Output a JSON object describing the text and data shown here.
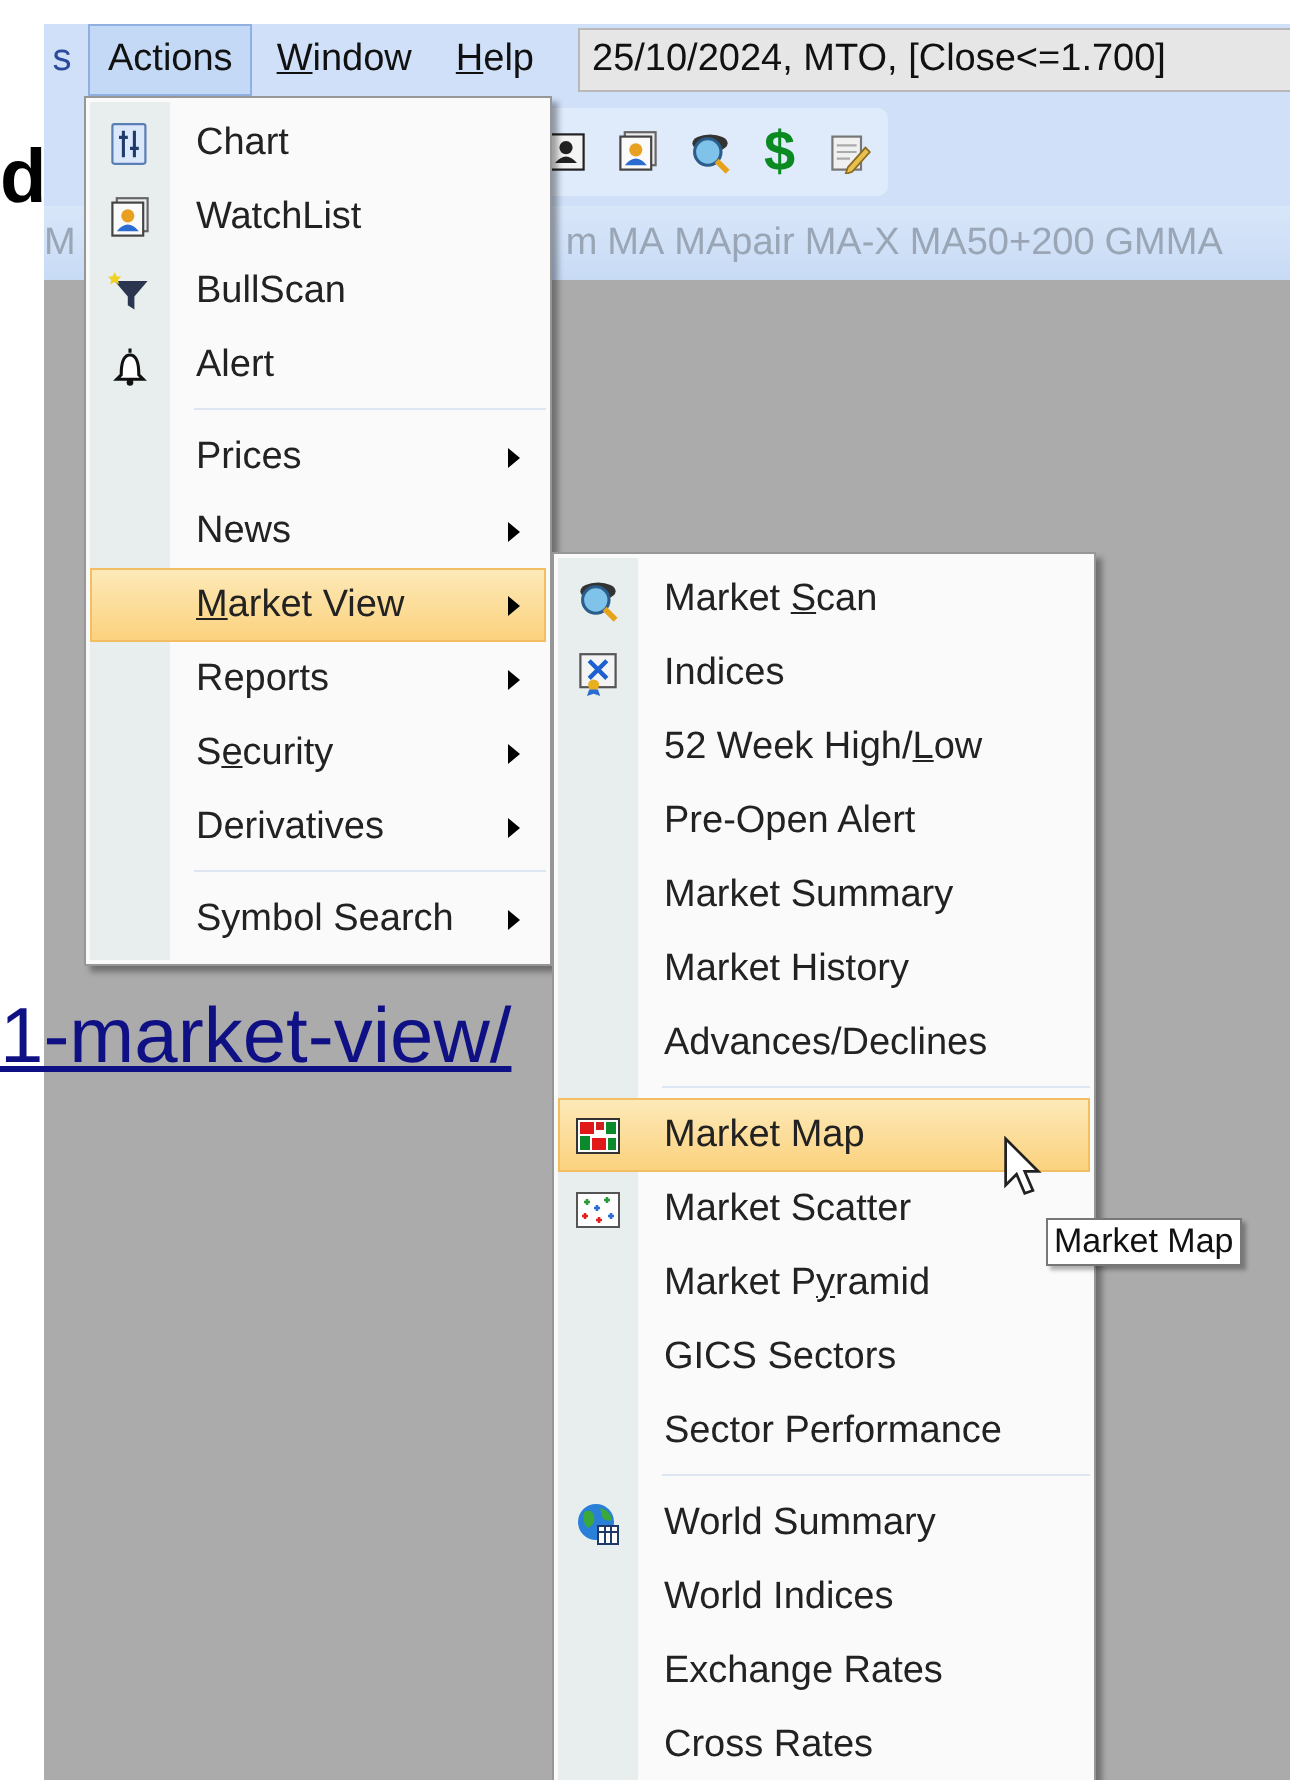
{
  "page_fragments": {
    "heading_letter": "d",
    "link": "1-market-view/"
  },
  "menubar": [
    {
      "label": [
        {
          "text": "s",
          "underline": false
        }
      ],
      "selected": false
    },
    {
      "label": [
        {
          "text": "Actions",
          "underline": false
        }
      ],
      "selected": true
    },
    {
      "label": [
        {
          "text": "W",
          "underline": true
        },
        {
          "text": "indow",
          "underline": false
        }
      ],
      "selected": false
    },
    {
      "label": [
        {
          "text": "H",
          "underline": true
        },
        {
          "text": "elp",
          "underline": false
        }
      ],
      "selected": false
    }
  ],
  "status_field": {
    "value": "25/10/2024, MTO, [Close<=1.700]"
  },
  "toolbar": [
    {
      "kind": "icon"
    },
    {
      "kind": "icon"
    },
    {
      "kind": "icon"
    },
    {
      "kind": "glyph",
      "label": "$"
    },
    {
      "kind": "icon"
    }
  ],
  "indicator_tabs": [
    "M",
    "m",
    "MA",
    "MApair",
    "MA-X",
    "MA50+200",
    "GMMA"
  ],
  "actions_menu": [
    {
      "kind": "item",
      "label": [
        {
          "text": "Chart",
          "underline": false
        }
      ],
      "selected": false,
      "has_submenu": false
    },
    {
      "kind": "item",
      "label": [
        {
          "text": "WatchList",
          "underline": false
        }
      ],
      "selected": false,
      "has_submenu": false
    },
    {
      "kind": "item",
      "label": [
        {
          "text": "BullScan",
          "underline": false
        }
      ],
      "selected": false,
      "has_submenu": false
    },
    {
      "kind": "item",
      "label": [
        {
          "text": "Alert",
          "underline": false
        }
      ],
      "selected": false,
      "has_submenu": false
    },
    {
      "kind": "separator"
    },
    {
      "kind": "item",
      "label": [
        {
          "text": "Prices",
          "underline": false
        }
      ],
      "selected": false,
      "has_submenu": true
    },
    {
      "kind": "item",
      "label": [
        {
          "text": "News",
          "underline": false
        }
      ],
      "selected": false,
      "has_submenu": true
    },
    {
      "kind": "item",
      "label": [
        {
          "text": "M",
          "underline": true
        },
        {
          "text": "arket View",
          "underline": false
        }
      ],
      "selected": true,
      "has_submenu": true
    },
    {
      "kind": "item",
      "label": [
        {
          "text": "Reports",
          "underline": false
        }
      ],
      "selected": false,
      "has_submenu": true
    },
    {
      "kind": "item",
      "label": [
        {
          "text": "S",
          "underline": false
        },
        {
          "text": "e",
          "underline": true
        },
        {
          "text": "curity",
          "underline": false
        }
      ],
      "selected": false,
      "has_submenu": true
    },
    {
      "kind": "item",
      "label": [
        {
          "text": "Derivatives",
          "underline": false
        }
      ],
      "selected": false,
      "has_submenu": true
    },
    {
      "kind": "separator"
    },
    {
      "kind": "item",
      "label": [
        {
          "text": "Symbol Search",
          "underline": false
        }
      ],
      "selected": false,
      "has_submenu": true
    }
  ],
  "market_view_menu": [
    {
      "kind": "item",
      "label": [
        {
          "text": "Market ",
          "underline": false
        },
        {
          "text": "S",
          "underline": true
        },
        {
          "text": "can",
          "underline": false
        }
      ],
      "selected": false
    },
    {
      "kind": "item",
      "label": [
        {
          "text": "Indices",
          "underline": false
        }
      ],
      "selected": false
    },
    {
      "kind": "item",
      "label": [
        {
          "text": "52 Week High/",
          "underline": false
        },
        {
          "text": "L",
          "underline": true
        },
        {
          "text": "ow",
          "underline": false
        }
      ],
      "selected": false
    },
    {
      "kind": "item",
      "label": [
        {
          "text": "Pre-Open Alert",
          "underline": false
        }
      ],
      "selected": false
    },
    {
      "kind": "item",
      "label": [
        {
          "text": "Market Summary",
          "underline": false
        }
      ],
      "selected": false
    },
    {
      "kind": "item",
      "label": [
        {
          "text": "Market History",
          "underline": false
        }
      ],
      "selected": false
    },
    {
      "kind": "item",
      "label": [
        {
          "text": "Advances/Declines",
          "underline": false
        }
      ],
      "selected": false
    },
    {
      "kind": "separator"
    },
    {
      "kind": "item",
      "label": [
        {
          "text": "Market Map",
          "underline": false
        }
      ],
      "selected": true
    },
    {
      "kind": "item",
      "label": [
        {
          "text": "Market Scatter",
          "underline": false
        }
      ],
      "selected": false
    },
    {
      "kind": "item",
      "label": [
        {
          "text": "Market P",
          "underline": false
        },
        {
          "text": "y",
          "underline": true
        },
        {
          "text": "ramid",
          "underline": false
        }
      ],
      "selected": false
    },
    {
      "kind": "item",
      "label": [
        {
          "text": "GICS Sectors",
          "underline": false
        }
      ],
      "selected": false
    },
    {
      "kind": "item",
      "label": [
        {
          "text": "Sector Performance",
          "underline": false
        }
      ],
      "selected": false
    },
    {
      "kind": "separator"
    },
    {
      "kind": "item",
      "label": [
        {
          "text": "World Summary",
          "underline": false
        }
      ],
      "selected": false
    },
    {
      "kind": "item",
      "label": [
        {
          "text": "World Indices",
          "underline": false
        }
      ],
      "selected": false
    },
    {
      "kind": "item",
      "label": [
        {
          "text": "Exchange Rates",
          "underline": false
        }
      ],
      "selected": false
    },
    {
      "kind": "item",
      "label": [
        {
          "text": "Cross Rates",
          "underline": false
        }
      ],
      "selected": false
    }
  ],
  "tooltip": "Market Map"
}
